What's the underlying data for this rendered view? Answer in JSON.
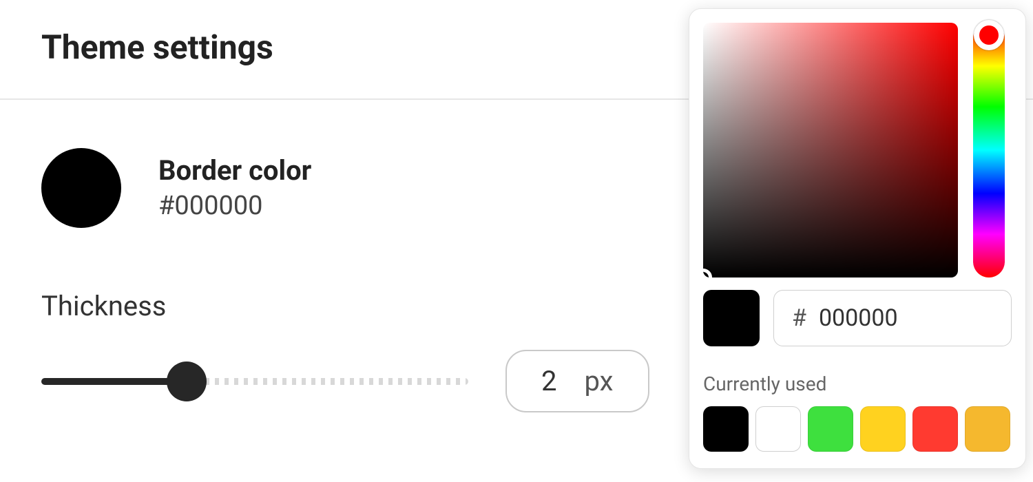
{
  "title": "Theme settings",
  "border_color": {
    "label": "Border color",
    "hex_display": "#000000",
    "swatch_color": "#000000"
  },
  "thickness": {
    "label": "Thickness",
    "value": "2",
    "unit": "px",
    "slider_fill_percent": 34
  },
  "picker": {
    "hue_base": "#ff0000",
    "current_color": "#000000",
    "hex_value": "000000",
    "hash": "#",
    "currently_used_label": "Currently used",
    "swatches": [
      "#000000",
      "#ffffff",
      "#3ee03e",
      "#ffd21f",
      "#ff3a30",
      "#f5b82e"
    ]
  }
}
